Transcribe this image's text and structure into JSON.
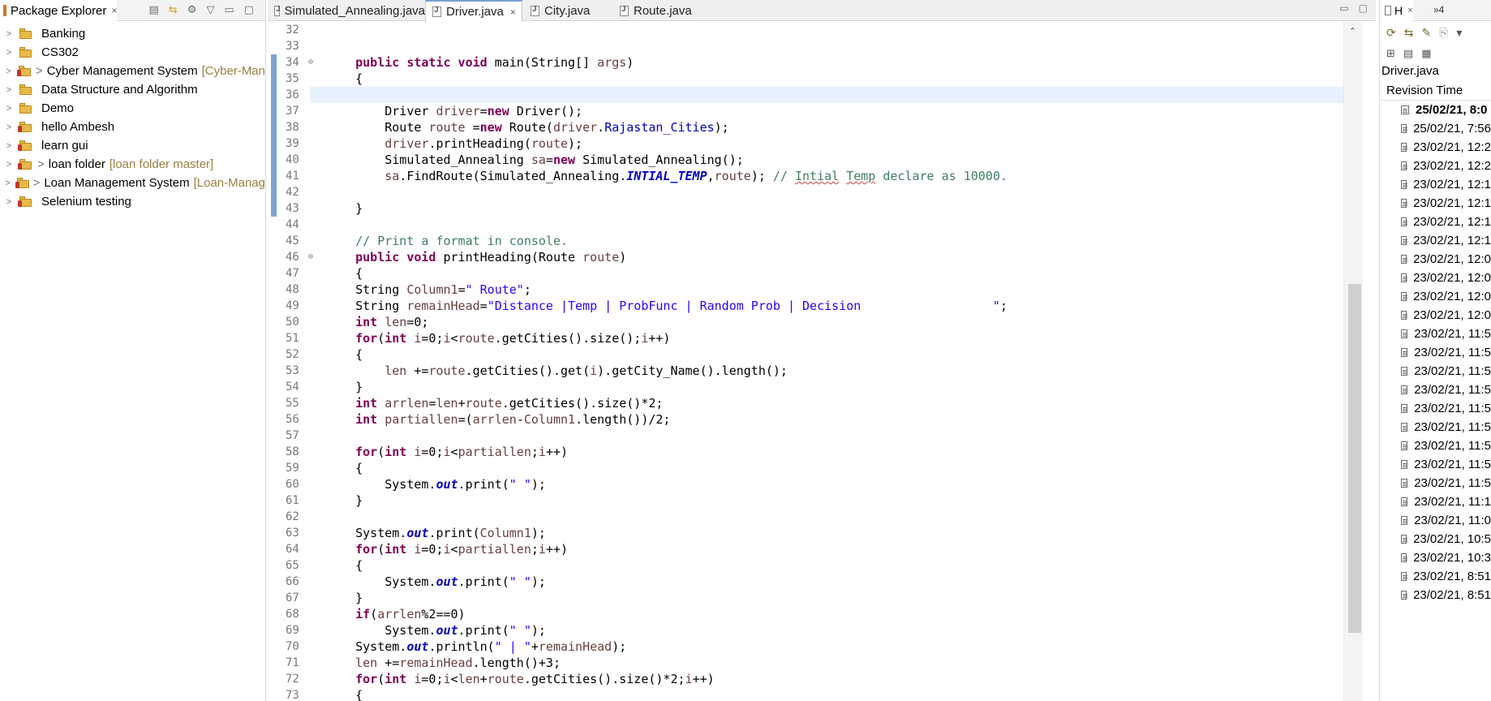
{
  "package_explorer": {
    "title": "Package Explorer",
    "close": "×",
    "projects": [
      {
        "name": "Banking",
        "dirty": "",
        "branch": ""
      },
      {
        "name": "CS302",
        "dirty": "",
        "branch": ""
      },
      {
        "name": "Cyber Management System",
        "dirty": ">",
        "branch": "[Cyber-Man"
      },
      {
        "name": "Data Structure and Algorithm",
        "dirty": "",
        "branch": ""
      },
      {
        "name": "Demo",
        "dirty": "",
        "branch": ""
      },
      {
        "name": "hello Ambesh",
        "dirty": "",
        "branch": ""
      },
      {
        "name": "learn gui",
        "dirty": "",
        "branch": ""
      },
      {
        "name": "loan folder",
        "dirty": ">",
        "branch": "[loan folder master]"
      },
      {
        "name": "Loan Management System",
        "dirty": ">",
        "branch": "[Loan-Manag"
      },
      {
        "name": "Selenium testing",
        "dirty": "",
        "branch": ""
      }
    ]
  },
  "editor": {
    "tabs": [
      {
        "label": "Simulated_Annealing.java",
        "active": false
      },
      {
        "label": "Driver.java",
        "active": true,
        "close": "×"
      },
      {
        "label": "City.java",
        "active": false
      },
      {
        "label": "Route.java",
        "active": false
      }
    ],
    "line_numbers": [
      "32",
      "33",
      "34",
      "35",
      "36",
      "37",
      "38",
      "39",
      "40",
      "41",
      "42",
      "43",
      "44",
      "45",
      "46",
      "47",
      "48",
      "49",
      "50",
      "51",
      "52",
      "53",
      "54",
      "55",
      "56",
      "57",
      "58",
      "59",
      "60",
      "61",
      "62",
      "63",
      "64",
      "65",
      "66",
      "67",
      "68",
      "69",
      "70",
      "71",
      "72",
      "73"
    ],
    "fold_markers": {
      "34": "⊖",
      "46": "⊖"
    },
    "current_line": "36"
  },
  "history": {
    "tab_label": "H",
    "close": "×",
    "more": "»4",
    "file": "Driver.java",
    "column": "Revision Time",
    "revisions": [
      {
        "time": "25/02/21, 8:0",
        "bold": true
      },
      {
        "time": "25/02/21, 7:56"
      },
      {
        "time": "23/02/21, 12:2"
      },
      {
        "time": "23/02/21, 12:2"
      },
      {
        "time": "23/02/21, 12:1"
      },
      {
        "time": "23/02/21, 12:1"
      },
      {
        "time": "23/02/21, 12:1"
      },
      {
        "time": "23/02/21, 12:1"
      },
      {
        "time": "23/02/21, 12:0"
      },
      {
        "time": "23/02/21, 12:0"
      },
      {
        "time": "23/02/21, 12:0"
      },
      {
        "time": "23/02/21, 12:0"
      },
      {
        "time": "23/02/21, 11:5"
      },
      {
        "time": "23/02/21, 11:5"
      },
      {
        "time": "23/02/21, 11:5"
      },
      {
        "time": "23/02/21, 11:5"
      },
      {
        "time": "23/02/21, 11:5"
      },
      {
        "time": "23/02/21, 11:5"
      },
      {
        "time": "23/02/21, 11:5"
      },
      {
        "time": "23/02/21, 11:5"
      },
      {
        "time": "23/02/21, 11:5"
      },
      {
        "time": "23/02/21, 11:1"
      },
      {
        "time": "23/02/21, 11:0"
      },
      {
        "time": "23/02/21, 10:5"
      },
      {
        "time": "23/02/21, 10:3"
      },
      {
        "time": "23/02/21, 8:51"
      },
      {
        "time": "23/02/21, 8:51"
      }
    ]
  },
  "colors": {
    "keyword": "#7f0055",
    "comment": "#3f7f5f",
    "string": "#2a00ff",
    "field": "#0000c0",
    "variable": "#6a3e3e",
    "current_line": "#e8f2fe"
  },
  "icons": [
    "java-file-icon",
    "project-folder-icon",
    "git-repo-icon",
    "revision-icon",
    "collapse-all-icon",
    "link-editor-icon",
    "view-menu-icon",
    "minimize-icon",
    "maximize-icon",
    "fold-icon",
    "scroll-up-icon"
  ]
}
